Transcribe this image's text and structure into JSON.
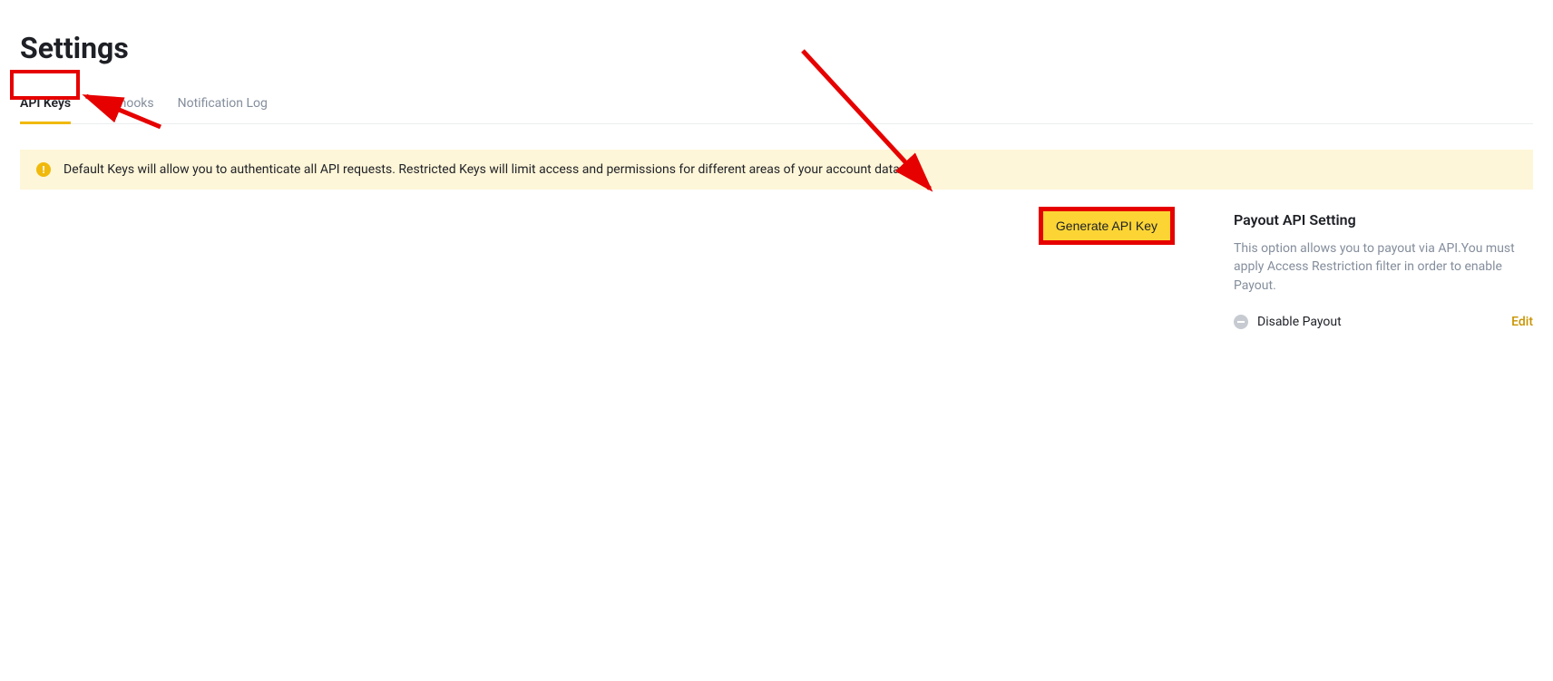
{
  "page_title": "Settings",
  "tabs": [
    {
      "label": "API Keys"
    },
    {
      "label": "Webhooks"
    },
    {
      "label": "Notification Log"
    }
  ],
  "info_banner": "Default Keys will allow you to authenticate all API requests. Restricted Keys will limit access and permissions for different areas of your account data.",
  "generate_button": "Generate API Key",
  "payout": {
    "title": "Payout API Setting",
    "desc": "This option allows you to payout via API.You must apply Access Restriction filter in order to enable Payout.",
    "status_label": "Disable Payout",
    "edit_label": "Edit"
  },
  "colors": {
    "accent": "#f0b90b",
    "highlight": "#e60000"
  }
}
